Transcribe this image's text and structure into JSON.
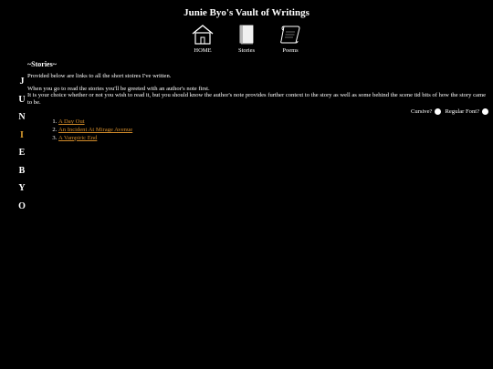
{
  "site": {
    "title": "Junie Byo's Vault of Writings"
  },
  "nav": [
    {
      "label": "HOME",
      "icon": "house-icon"
    },
    {
      "label": "Stories",
      "icon": "book-icon"
    },
    {
      "label": "Poems",
      "icon": "scroll-icon"
    }
  ],
  "side_letters": [
    "J",
    "U",
    "N",
    "I",
    "E",
    "B",
    "Y",
    "O"
  ],
  "colors": {
    "background": "#000000",
    "text": "#ffffff",
    "accent": "#d08a2a",
    "highlight_letter": "#e0a030"
  },
  "main": {
    "section_title": "~Stories~",
    "intro": "Provided below are links to all the short stoires I've written.",
    "note_line1": "When you go to read the stories you'll be greeted with an author's note first.",
    "note_line2": "It is your choice whether or not you wish to read it, but you should know the author's note provides further context to the story as well as some behind the scene tid bits of how the story came to be.",
    "font_options": {
      "cursive_label": "Cursive?",
      "regular_label": "Regular Font?"
    },
    "stories": [
      "A Day Out",
      "An Incident At Mirage Avenue",
      "A Vampiric End"
    ]
  }
}
